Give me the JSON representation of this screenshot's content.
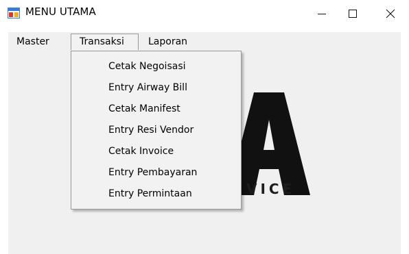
{
  "window": {
    "title": "MENU UTAMA",
    "controls": {
      "minimize": "—",
      "maximize": "☐",
      "close": "✕"
    }
  },
  "menubar": {
    "items": [
      {
        "label": "Master"
      },
      {
        "label": "Transaksi"
      },
      {
        "label": "Laporan"
      }
    ]
  },
  "dropdown": {
    "items": [
      {
        "label": "Cetak Negoisasi"
      },
      {
        "label": "Entry Airway Bill"
      },
      {
        "label": "Cetak Manifest"
      },
      {
        "label": "Entry Resi Vendor"
      },
      {
        "label": "Cetak Invoice"
      },
      {
        "label": "Entry Pembayaran"
      },
      {
        "label": "Entry Permintaan"
      }
    ]
  },
  "background": {
    "logo_text": "VICE"
  },
  "colors": {
    "client_bg": "#f0f0f0",
    "menu_bg": "#f2f2f2",
    "menu_border": "#999999",
    "icon_red": "#d9392a",
    "icon_blue": "#3a7bd5",
    "icon_yellow": "#f2b01e"
  }
}
